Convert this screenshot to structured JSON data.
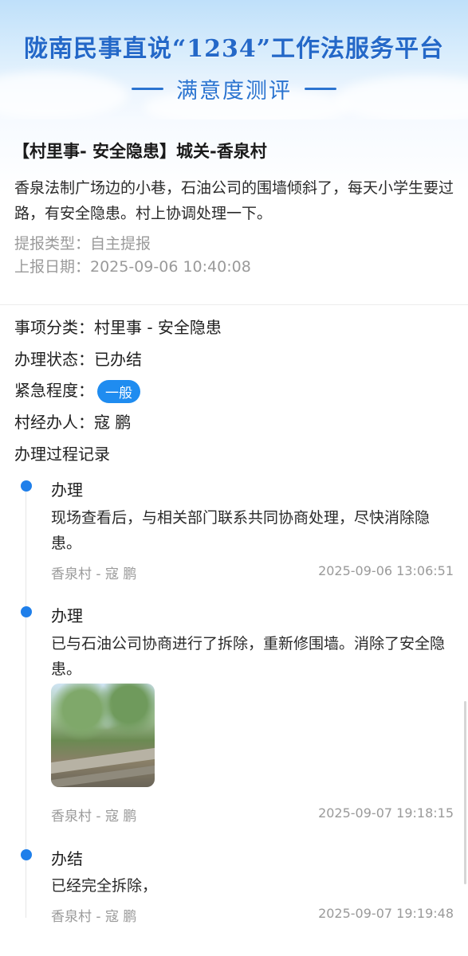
{
  "header": {
    "title": "陇南民事直说“1234”工作法服务平台",
    "subtitle": "满意度测评"
  },
  "issue": {
    "title": "【村里事- 安全隐患】城关-香泉村",
    "description": "香泉法制广场边的小巷，石油公司的围墙倾斜了，每天小学生要过路，有安全隐患。村上协调处理一下。",
    "report_type": "提报类型：自主提报",
    "report_date": "上报日期：2025-09-06 10:40:08"
  },
  "details": {
    "category": "事项分类：村里事 - 安全隐患",
    "status": "办理状态：已办结",
    "urgency_label": "紧急程度：",
    "urgency_value": "一般",
    "handler": "村经办人：寇 鹏",
    "process_heading": "办理过程记录"
  },
  "timeline": [
    {
      "type": "办理",
      "text": "现场查看后，与相关部门联系共同协商处理，尽快消除隐患。",
      "who": "香泉村 - 寇 鹏",
      "time": "2025-09-06 13:06:51"
    },
    {
      "type": "办理",
      "text": "已与石油公司协商进行了拆除，重新修围墙。消除了安全隐患。",
      "who": "香泉村 - 寇 鹏",
      "time": "2025-09-07 19:18:15"
    },
    {
      "type": "办结",
      "text": "已经完全拆除，",
      "who": "香泉村 - 寇 鹏",
      "time": "2025-09-07 19:19:48"
    }
  ],
  "colors": {
    "accent": "#1f7fea",
    "title_blue": "#2468c8",
    "muted": "#9a9a9a"
  }
}
